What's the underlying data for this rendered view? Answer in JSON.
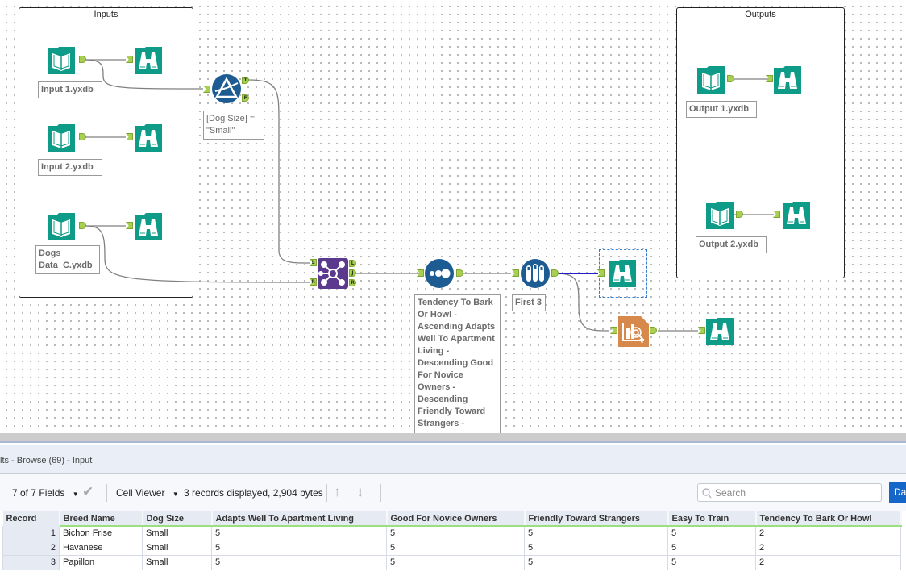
{
  "canvas": {
    "containers": [
      {
        "title": "Inputs"
      },
      {
        "title": "Outputs"
      }
    ],
    "tools": {
      "input1": {
        "type": "input-data",
        "annotation": "Input 1.yxdb"
      },
      "input2": {
        "type": "input-data",
        "annotation": "Input 2.yxdb"
      },
      "input3": {
        "type": "input-data",
        "annotation": "Dogs Data_C.yxdb"
      },
      "output1": {
        "type": "output-data",
        "annotation": "Output 1.yxdb"
      },
      "output2": {
        "type": "output-data",
        "annotation": "Output 2.yxdb"
      },
      "filter": {
        "type": "filter",
        "annotation": "[Dog Size] = \"Small\"",
        "anchors": {
          "in": "",
          "true": "T",
          "false": "F"
        }
      },
      "join": {
        "type": "join",
        "anchors": {
          "left_in": "L",
          "right_in": "R",
          "left_out": "L",
          "join_out": "J",
          "right_out": "R"
        }
      },
      "sort": {
        "type": "sort",
        "annotation": "Tendency To Bark Or Howl - Ascending Adapts Well To Apartment Living - Descending Good For Novice Owners - Descending Friendly Toward Strangers -"
      },
      "sample": {
        "type": "sample",
        "annotation": "First 3"
      },
      "insight": {
        "type": "insight"
      },
      "browse": {
        "type": "browse"
      }
    },
    "colors": {
      "teal": "#0e9b87",
      "blue": "#1d5b93",
      "purple": "#5b3a8e",
      "orange": "#d6894b",
      "anchor_green": "#a8cf52",
      "selected_wire": "#2020c8"
    }
  },
  "results": {
    "title": "lts - Browse (69) - Input",
    "toolbar": {
      "fields": "7 of 7 Fields",
      "viewer": "Cell Viewer",
      "status": "3 records displayed, 2,904 bytes",
      "search_placeholder": "Search",
      "data_button": "Da"
    },
    "columns": [
      "Record",
      "Breed Name",
      "Dog Size",
      "Adapts Well To Apartment Living",
      "Good For Novice Owners",
      "Friendly Toward Strangers",
      "Easy To Train",
      "Tendency To Bark Or Howl"
    ],
    "rows": [
      [
        "1",
        "Bichon Frise",
        "Small",
        "5",
        "5",
        "5",
        "5",
        "2"
      ],
      [
        "2",
        "Havanese",
        "Small",
        "5",
        "5",
        "5",
        "5",
        "2"
      ],
      [
        "3",
        "Papillon",
        "Small",
        "5",
        "5",
        "5",
        "5",
        "2"
      ]
    ]
  }
}
